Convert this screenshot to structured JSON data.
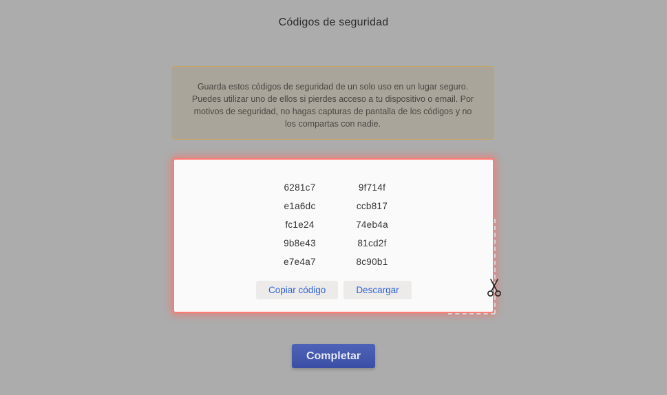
{
  "header": {
    "title": "Códigos de seguridad"
  },
  "notice": {
    "text": "Guarda estos códigos de seguridad de un solo uso en un lugar seguro. Puedes utilizar uno de ellos si pierdes acceso a tu dispositivo o email. Por motivos de seguridad, no hagas capturas de pantalla de los códigos y no los compartas con nadie."
  },
  "codes": {
    "rows": [
      [
        "6281c7",
        "9f714f"
      ],
      [
        "e1a6dc",
        "ccb817"
      ],
      [
        "fc1e24",
        "74eb4a"
      ],
      [
        "9b8e43",
        "81cd2f"
      ],
      [
        "e7e4a7",
        "8c90b1"
      ]
    ],
    "copy_label": "Copiar código",
    "download_label": "Descargar"
  },
  "footer": {
    "complete_label": "Completar"
  },
  "colors": {
    "backdrop": "#acacac",
    "notice_border": "#c8a45e",
    "panel_highlight": "#ff7a72",
    "link_blue": "#2f62d8",
    "primary_button": "#3f52a8"
  },
  "icons": {
    "snip_tool": "scissors-icon"
  }
}
